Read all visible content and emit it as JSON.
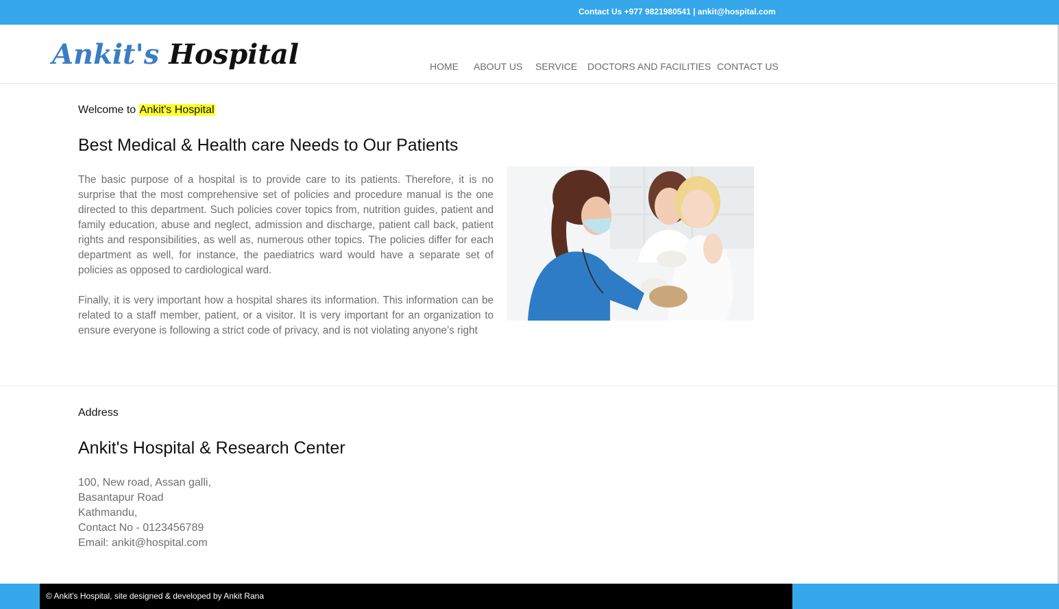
{
  "topbar": {
    "contact_text": "Contact Us +977 9821980541 | ankit@hospital.com"
  },
  "header": {
    "logo_part1": "Ankit's",
    "logo_part2": "Hospital",
    "nav": [
      {
        "label": "HOME"
      },
      {
        "label": "ABOUT US"
      },
      {
        "label": "SERVICE"
      },
      {
        "label": "DOCTORS AND FACILITIES"
      },
      {
        "label": "CONTACT US"
      }
    ]
  },
  "intro": {
    "welcome_prefix": "Welcome to",
    "welcome_highlight": "Ankit's Hospital",
    "heading": "Best Medical & Health care Needs to Our Patients",
    "paragraph1": "The basic purpose of a hospital is to provide care to its patients. Therefore, it is no surprise that the most comprehensive set of policies and procedure manual is the one directed to this department. Such policies cover topics from, nutrition guides, patient and family education, abuse and neglect, admission and discharge, patient call back, patient rights and responsibilities, as well as, numerous other topics. The policies differ for each department as well, for instance, the paediatrics ward would have a separate set of policies as opposed to cardiological ward.",
    "paragraph2": "Finally, it is very important how a hospital shares its information. This information can be related to a staff member, patient, or a visitor. It is very important for an organization to ensure everyone is following a strict code of privacy, and is not violating anyone’s right"
  },
  "address": {
    "label": "Address",
    "heading": "Ankit's Hospital & Research Center",
    "lines": [
      "100, New road, Assan galli,",
      "Basantapur Road",
      "Kathmandu,",
      "Contact No - 0123456789",
      "Email: ankit@hospital.com"
    ]
  },
  "footer": {
    "text": "© Ankit's Hospital, site designed & developed by Ankit Rana"
  },
  "colors": {
    "accent": "#35a7ea",
    "logo_blue": "#3a7dc4",
    "highlight": "#ffff2a"
  }
}
